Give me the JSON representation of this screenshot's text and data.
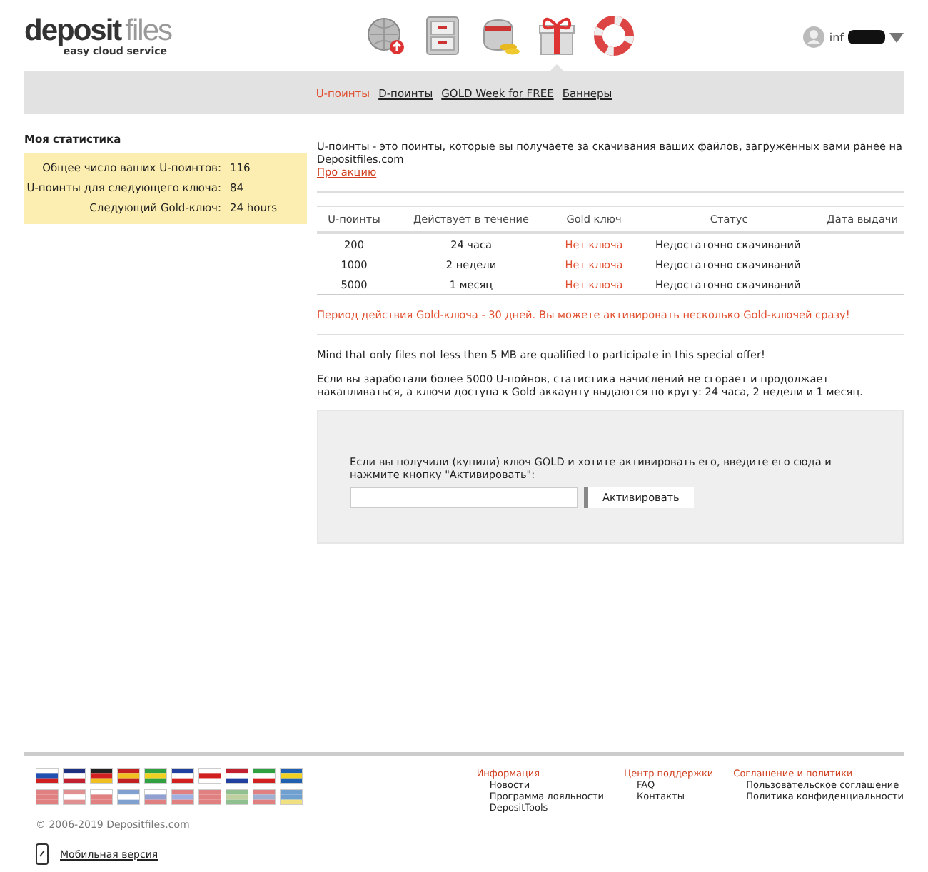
{
  "logo": {
    "name_bold": "deposit",
    "name_light": "files",
    "tagline": "easy cloud service"
  },
  "nav_icons": [
    {
      "kind": "upload",
      "selected": false
    },
    {
      "kind": "cabinet",
      "selected": false
    },
    {
      "kind": "purse",
      "selected": false
    },
    {
      "kind": "gift",
      "selected": true
    },
    {
      "kind": "lifebuoy",
      "selected": false
    }
  ],
  "user": {
    "name": "inf"
  },
  "subnav": [
    {
      "label": "U-поинты",
      "selected": true
    },
    {
      "label": "D-поинты",
      "selected": false
    },
    {
      "label": "GOLD Week for FREE",
      "selected": false
    },
    {
      "label": "Баннеры",
      "selected": false
    }
  ],
  "sidebar": {
    "title": "Моя статистика",
    "stats": [
      {
        "label": "Общее число ваших U-поинтов:",
        "value": "116"
      },
      {
        "label": "U-поинты для следующего ключа:",
        "value": "84"
      },
      {
        "label": "Следующий Gold-ключ:",
        "value": "24 hours"
      }
    ]
  },
  "intro": {
    "text": "U-поинты - это поинты, которые вы получаете за скачивания ваших файлов, загруженных вами ранее на Depositfiles.com",
    "link": "Про акцию"
  },
  "table": {
    "columns": [
      "U-поинты",
      "Действует в течение",
      "Gold ключ",
      "Статус",
      "Дата выдачи"
    ],
    "rows": [
      {
        "points": "200",
        "duration": "24 часа",
        "key": "Нет ключа",
        "status": "Недостаточно скачиваний"
      },
      {
        "points": "1000",
        "duration": "2 недели",
        "key": "Нет ключа",
        "status": "Недостаточно скачиваний"
      },
      {
        "points": "5000",
        "duration": "1 месяц",
        "key": "Нет ключа",
        "status": "Недостаточно скачиваний"
      }
    ]
  },
  "notice": "Период действия Gold-ключа - 30 дней. Вы можете активировать несколько Gold-ключей сразу!",
  "notes": [
    "Mind that only files not less then 5 MB are qualified to participate in this special offer!",
    "Если вы заработали более 5000 U-пойнов, статистика начислений не сгорает и продолжает накапливаться, а ключи доступа к Gold аккаунту выдаются по кругу: 24 часа, 2 недели и 1 месяц."
  ],
  "activate": {
    "prompt": "Если вы получили (купили) ключ GOLD и хотите активировать его, введите его сюда и нажмите кнопку \"Активировать\":",
    "button": "Активировать"
  },
  "footer": {
    "copyright": "© 2006-2019 Depositfiles.com",
    "mobile": "Мобильная версия",
    "columns": [
      {
        "title": "Информация",
        "links": [
          "Новости",
          "Программа лояльности",
          "DepositTools"
        ]
      },
      {
        "title": "Центр поддержки",
        "links": [
          "FAQ",
          "Контакты"
        ]
      },
      {
        "title": "Соглашение и политики",
        "links": [
          "Пользовательское соглашение",
          "Политика конфиденциальности"
        ]
      }
    ]
  }
}
